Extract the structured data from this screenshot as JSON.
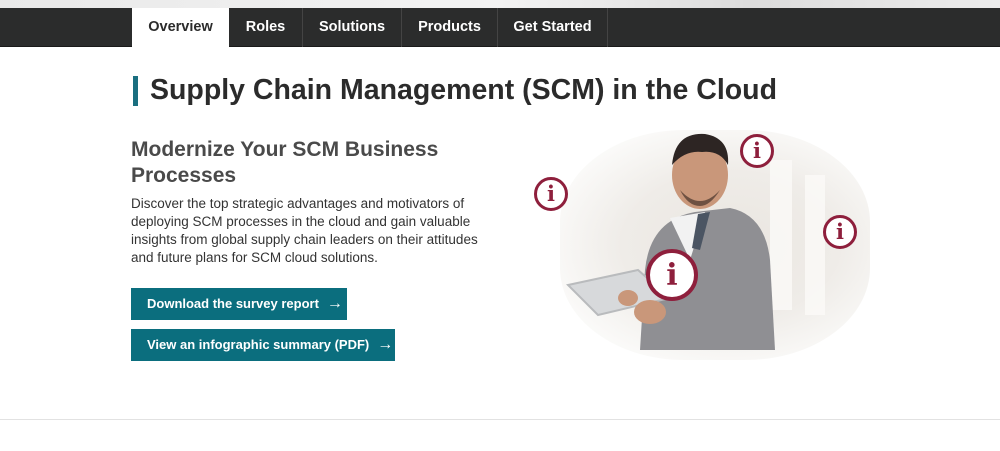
{
  "nav": {
    "tabs": [
      {
        "label": "Overview",
        "active": true
      },
      {
        "label": "Roles",
        "active": false
      },
      {
        "label": "Solutions",
        "active": false
      },
      {
        "label": "Products",
        "active": false
      },
      {
        "label": "Get Started",
        "active": false
      }
    ]
  },
  "main": {
    "title": "Supply Chain Management (SCM) in the Cloud",
    "subheading": "Modernize Your SCM Business Processes",
    "description": "Discover the top strategic advantages and motivators of deploying SCM processes in the cloud and gain valuable insights from global supply chain leaders on their attitudes and future plans for SCM cloud solutions.",
    "buttons": {
      "survey_label": "Download the survey report",
      "infographic_label": "View an infographic summary (PDF)",
      "arrow": "→"
    }
  },
  "hero": {
    "info_glyph": "i",
    "icon_color": "#8e1f3c"
  },
  "colors": {
    "nav_bg": "#2b2c2c",
    "accent": "#0b6e7e",
    "title_bar": "#1a6f80"
  }
}
